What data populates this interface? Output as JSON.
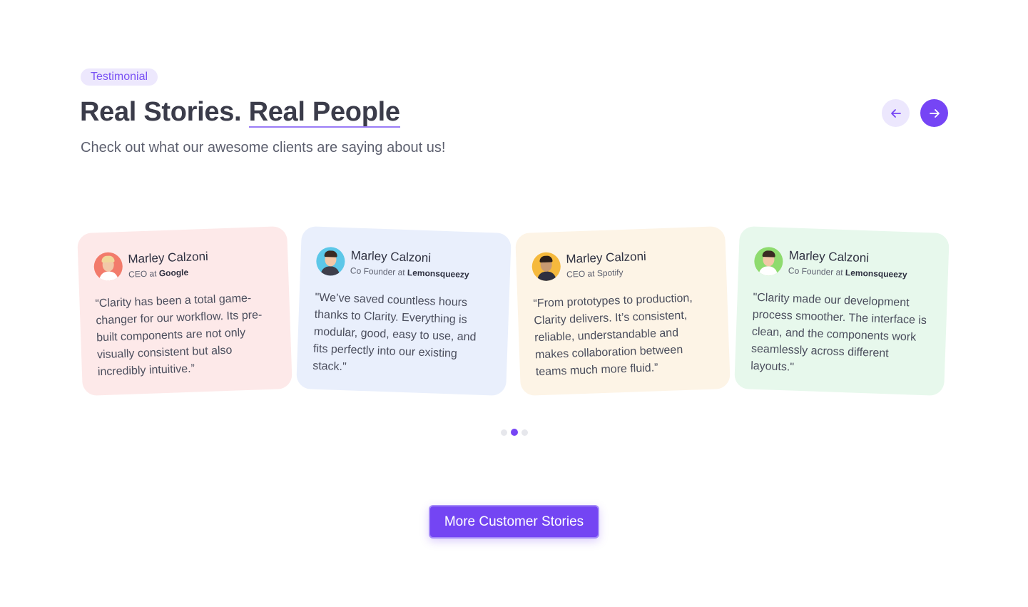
{
  "header": {
    "badge": "Testimonial",
    "title_prefix": "Real Stories.",
    "title_highlight": "Real People",
    "subtitle": "Check out what our awesome clients are saying about us!"
  },
  "nav": {
    "prev_icon": "arrow-left-icon",
    "next_icon": "arrow-right-icon"
  },
  "testimonials": [
    {
      "name": "Marley Calzoni",
      "role_prefix": "CEO at ",
      "company": "Google",
      "quote": "“Clarity has been a total game-changer for our workflow. Its pre-built components are not only visually consistent but also incredibly intuitive.”",
      "card_color": "#fde9e9",
      "avatar_color": "#f27b6b"
    },
    {
      "name": "Marley Calzoni",
      "role_prefix": "Co Founder at ",
      "company": "Lemonsqueezy",
      "quote": "\"We’ve saved countless hours thanks to Clarity. Everything is modular, good, easy to use, and fits perfectly into our existing stack.\"",
      "card_color": "#e9effc",
      "avatar_color": "#5cc7e8"
    },
    {
      "name": "Marley Calzoni",
      "role_prefix": "CEO at Spotify",
      "company": "",
      "quote": "“From prototypes to production, Clarity delivers. It’s consistent, reliable, understandable and makes collaboration between teams much more fluid.”",
      "card_color": "#fdf4e6",
      "avatar_color": "#f5b93d"
    },
    {
      "name": "Marley Calzoni",
      "role_prefix": "Co Founder at ",
      "company": "Lemonsqueezy",
      "quote": "\"Clarity made our development process smoother. The interface is clean, and the components work seamlessly across different layouts.\"",
      "card_color": "#e7f8ec",
      "avatar_color": "#8edb6e"
    }
  ],
  "pagination": {
    "count": 3,
    "active_index": 1
  },
  "cta": {
    "label": "More Customer Stories"
  },
  "colors": {
    "accent": "#7645f5",
    "accent_soft": "#ede8fd",
    "text": "#3b3c4a"
  }
}
